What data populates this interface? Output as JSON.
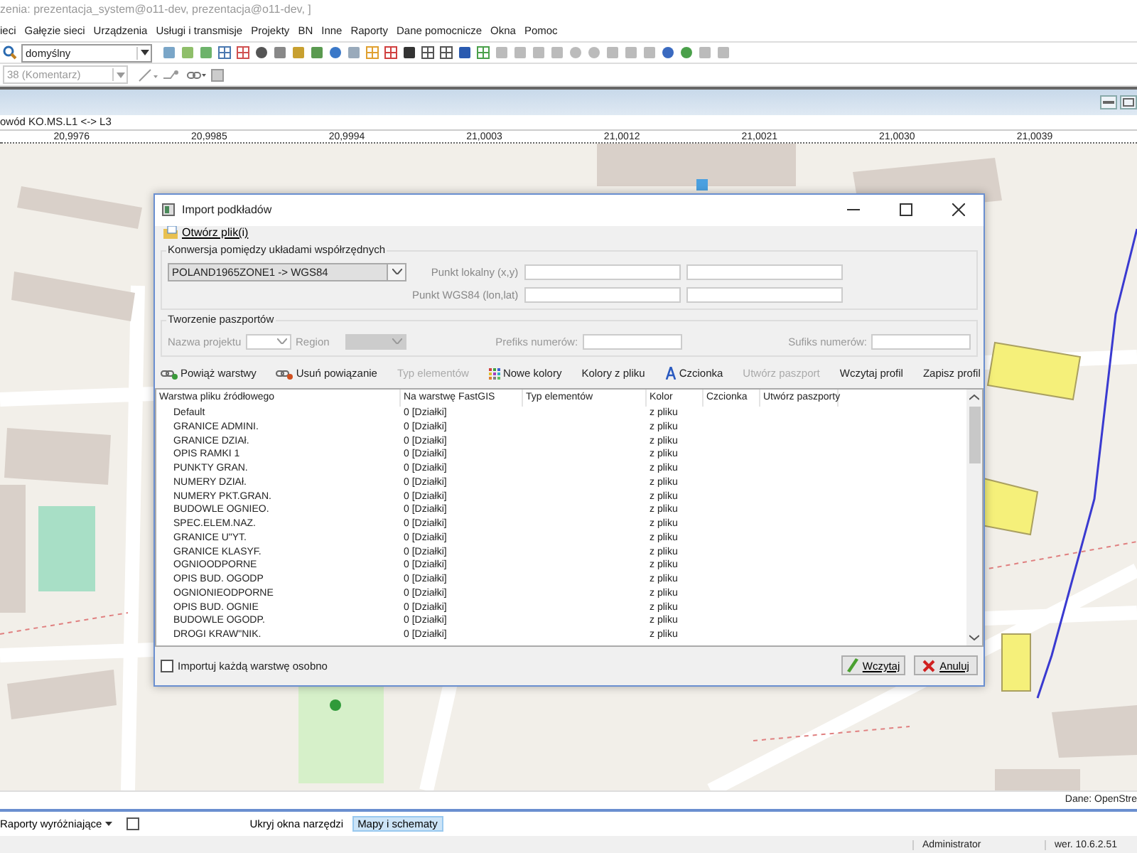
{
  "window": {
    "title": "zenia: prezentacja_system@o11-dev, prezentacja@o11-dev, ]"
  },
  "menu": [
    "ieci",
    "Gałęzie sieci",
    "Urządzenia",
    "Usługi i transmisje",
    "Projekty",
    "BN",
    "Inne",
    "Raporty",
    "Dane pomocnicze",
    "Okna",
    "Pomoc"
  ],
  "toolbar": {
    "profile_combo": "domyślny",
    "layer_combo": "38 (Komentarz)",
    "layer_combo_disabled": true
  },
  "map_window": {
    "title": "owód KO.MS.L1 <-> L3",
    "ruler": [
      "20,9976",
      "20,9985",
      "20,9994",
      "21,0003",
      "21,0012",
      "21,0021",
      "21,0030",
      "21,0039"
    ],
    "attribution": "Dane: OpenStre"
  },
  "dialog": {
    "title": "Import podkładów",
    "open_files": "Otwórz plik(i)",
    "conversion": {
      "legend": "Konwersja pomiędzy układami współrzędnych",
      "system": "POLAND1965ZONE1 -> WGS84",
      "local_label": "Punkt lokalny (x,y)",
      "wgs_label": "Punkt WGS84 (lon,lat)"
    },
    "passports": {
      "legend": "Tworzenie paszportów",
      "disabled": true,
      "project_label": "Nazwa projektu",
      "region_label": "Region",
      "prefix_label": "Prefiks numerów:",
      "suffix_label": "Sufiks numerów:"
    },
    "actions": [
      {
        "label": "Powiąż warstwy",
        "kind": "link",
        "disabled": false
      },
      {
        "label": "Usuń powiązanie",
        "kind": "unlink",
        "disabled": false
      },
      {
        "label": "Typ elementów",
        "kind": "plain",
        "disabled": true
      },
      {
        "label": "Nowe kolory",
        "kind": "palette",
        "disabled": false
      },
      {
        "label": "Kolory z pliku",
        "kind": "plain",
        "disabled": false
      },
      {
        "label": "Czcionka",
        "kind": "font",
        "disabled": false
      },
      {
        "label": "Utwórz paszport",
        "kind": "plain",
        "disabled": true
      },
      {
        "label": "Wczytaj profil",
        "kind": "plain",
        "disabled": false
      },
      {
        "label": "Zapisz profil",
        "kind": "plain",
        "disabled": false
      }
    ],
    "table": {
      "columns": [
        "Warstwa pliku źródłowego",
        "Na warstwę FastGIS",
        "Typ elementów",
        "Kolor",
        "Czcionka",
        "Utwórz paszporty"
      ],
      "rows": [
        {
          "layer": "Default",
          "target": "0  [Działki]",
          "colour_source": "z pliku"
        },
        {
          "layer": "GRANICE ADMINI.",
          "target": "0  [Działki]",
          "colour_source": "z pliku"
        },
        {
          "layer": "GRANICE DZIAł.",
          "target": "0  [Działki]",
          "colour_source": "z pliku"
        },
        {
          "layer": "OPIS RAMKI 1",
          "target": "0  [Działki]",
          "colour_source": "z pliku"
        },
        {
          "layer": "PUNKTY GRAN.",
          "target": "0  [Działki]",
          "colour_source": "z pliku"
        },
        {
          "layer": "NUMERY DZIAł.",
          "target": "0  [Działki]",
          "colour_source": "z pliku"
        },
        {
          "layer": "NUMERY PKT.GRAN.",
          "target": "0  [Działki]",
          "colour_source": "z pliku"
        },
        {
          "layer": "BUDOWLE OGNIEO.",
          "target": "0  [Działki]",
          "colour_source": "z pliku"
        },
        {
          "layer": "SPEC.ELEM.NAZ.",
          "target": "0  [Działki]",
          "colour_source": "z pliku"
        },
        {
          "layer": "GRANICE U\"YT.",
          "target": "0  [Działki]",
          "colour_source": "z pliku"
        },
        {
          "layer": "GRANICE KLASYF.",
          "target": "0  [Działki]",
          "colour_source": "z pliku"
        },
        {
          "layer": "OGNIOODPORNE",
          "target": "0  [Działki]",
          "colour_source": "z pliku"
        },
        {
          "layer": "OPIS BUD. OGODP",
          "target": "0  [Działki]",
          "colour_source": "z pliku"
        },
        {
          "layer": "OGNIONIEODPORNE",
          "target": "0  [Działki]",
          "colour_source": "z pliku"
        },
        {
          "layer": "OPIS BUD. OGNIE",
          "target": "0  [Działki]",
          "colour_source": "z pliku"
        },
        {
          "layer": "BUDOWLE OGODP.",
          "target": "0  [Działki]",
          "colour_source": "z pliku"
        },
        {
          "layer": "DROGI KRAW\"NIK.",
          "target": "0  [Działki]",
          "colour_source": "z pliku"
        }
      ]
    },
    "import_each": {
      "label": "Importuj każdą warstwę osobno",
      "checked": false
    },
    "buttons": [
      {
        "label": "Wczytaj",
        "kind": "ok"
      },
      {
        "label": "Anuluj",
        "kind": "cancel"
      }
    ]
  },
  "bottom_bar": {
    "reports": "Raporty wyróżniające",
    "report_checked": false,
    "hide_tools": "Ukryj okna narzędzi",
    "tabs": [
      {
        "label": "Mapy i schematy",
        "selected": true
      }
    ]
  },
  "status_bar": {
    "user": "Administrator",
    "version": "wer. 10.6.2.51"
  }
}
